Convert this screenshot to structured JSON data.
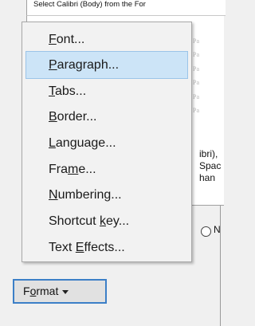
{
  "background": {
    "top_line_text": "Select Calibri (Body) from the For",
    "preview_lines": [
      "ng Pa",
      "ng Pa",
      "ng Pa",
      "ng Pa",
      "ng Pa",
      "ng Pa"
    ],
    "description_lines": [
      "ibri),",
      "Spac",
      "han"
    ],
    "radio_label": "N"
  },
  "menu": {
    "items": [
      {
        "pre": "",
        "u": "F",
        "post": "ont..."
      },
      {
        "pre": "",
        "u": "P",
        "post": "aragraph..."
      },
      {
        "pre": "",
        "u": "T",
        "post": "abs..."
      },
      {
        "pre": "",
        "u": "B",
        "post": "order..."
      },
      {
        "pre": "",
        "u": "L",
        "post": "anguage..."
      },
      {
        "pre": "Fra",
        "u": "m",
        "post": "e..."
      },
      {
        "pre": "",
        "u": "N",
        "post": "umbering..."
      },
      {
        "pre": "Shortcut ",
        "u": "k",
        "post": "ey..."
      },
      {
        "pre": "Text ",
        "u": "E",
        "post": "ffects..."
      }
    ],
    "hovered_index": 1
  },
  "format_button": {
    "pre": "F",
    "u": "o",
    "post": "rmat"
  }
}
